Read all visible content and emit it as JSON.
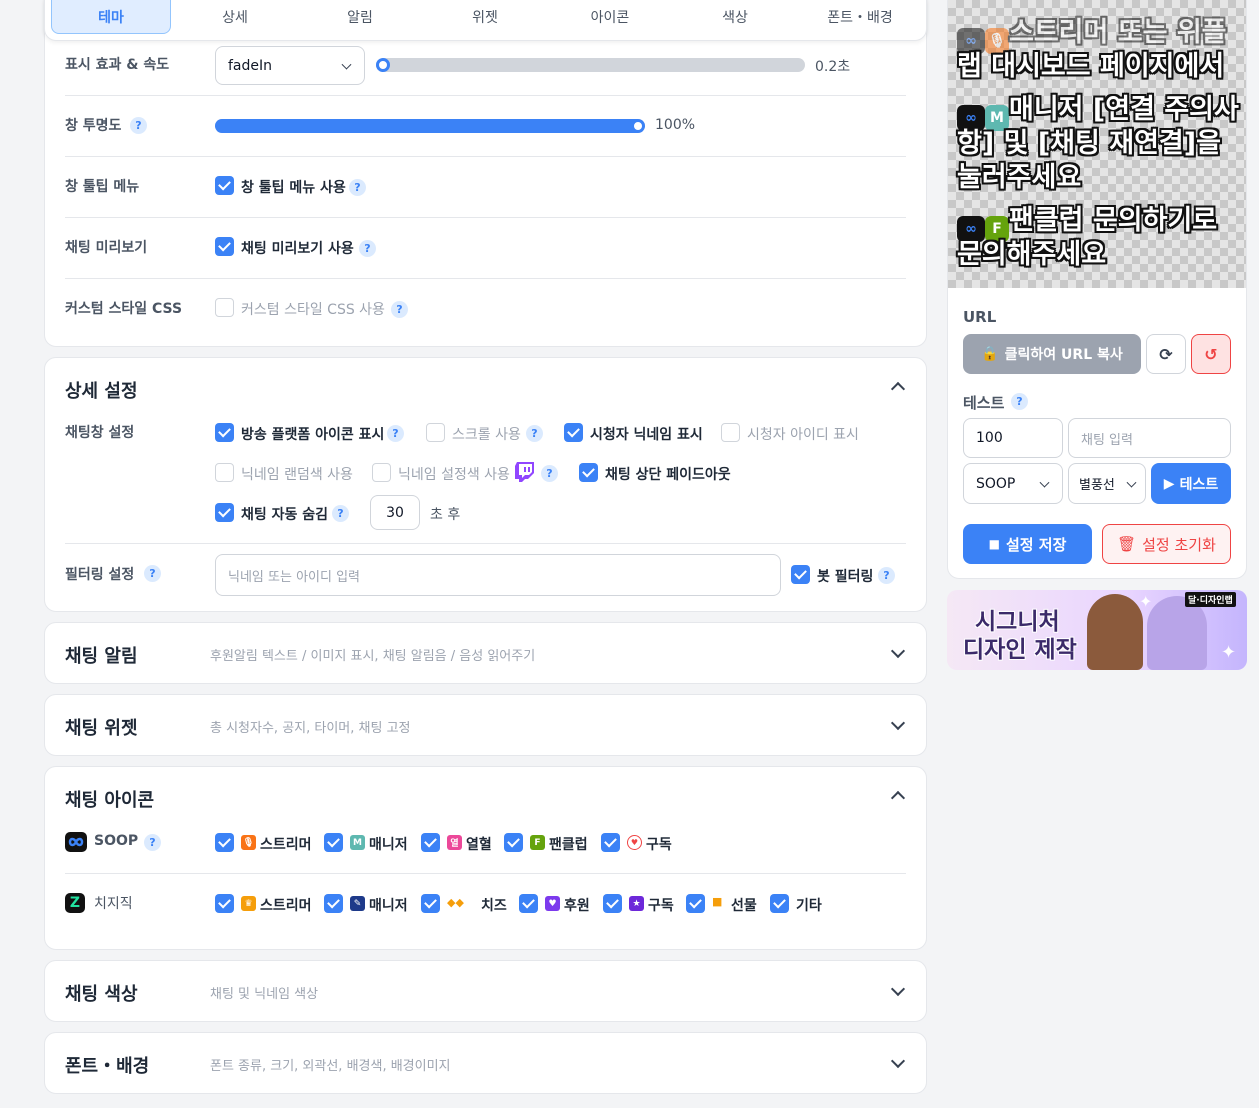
{
  "tabs": [
    {
      "label": "테마",
      "active": true
    },
    {
      "label": "상세",
      "active": false
    },
    {
      "label": "알림",
      "active": false
    },
    {
      "label": "위젯",
      "active": false
    },
    {
      "label": "아이콘",
      "active": false
    },
    {
      "label": "색상",
      "active": false
    },
    {
      "label": "폰트・배경",
      "active": false
    }
  ],
  "theme": {
    "effect_label": "표시 효과 & 속도",
    "effect_value": "fadeIn",
    "speed_value": "0.2초",
    "speed_fraction": 0.03,
    "opacity_label": "창 투명도",
    "opacity_value": "100%",
    "opacity_fraction": 1.0,
    "tooltip_label": "창 툴팁 메뉴",
    "tooltip_cb": "창 툴팁 메뉴 사용",
    "preview_label": "채팅 미리보기",
    "preview_cb": "채팅 미리보기 사용",
    "css_label": "커스텀 스타일 CSS",
    "css_cb": "커스텀 스타일 CSS 사용"
  },
  "detail": {
    "title": "상세 설정",
    "chat_label": "채팅창 설정",
    "options": {
      "platform_icon": "방송 플랫폼 아이콘 표시",
      "scroll": "스크롤 사용",
      "viewer_nick": "시청자 닉네임 표시",
      "viewer_id": "시청자 아이디 표시",
      "nick_random": "닉네임 랜덤색 사용",
      "nick_setcolor": "닉네임 설정색 사용",
      "top_fadeout": "채팅 상단 페이드아웃",
      "auto_hide": "채팅 자동 숨김"
    },
    "auto_hide_value": "30",
    "auto_hide_unit": "초 후",
    "filter_label": "필터링 설정",
    "filter_placeholder": "닉네임 또는 아이디 입력",
    "bot_filter": "봇 필터링"
  },
  "sections": {
    "alert_title": "채팅 알림",
    "alert_desc": "후원알림 텍스트 / 이미지 표시, 채팅 알림음 / 음성 읽어주기",
    "widget_title": "채팅 위젯",
    "widget_desc": "총 시청자수, 공지, 타이머, 채팅 고정",
    "icon_title": "채팅 아이콘",
    "color_title": "채팅 색상",
    "color_desc": "채팅 및 닉네임 색상",
    "font_title": "폰트・배경",
    "font_desc": "폰트 종류, 크기, 외곽선, 배경색, 배경이미지"
  },
  "icons": {
    "soop_label": "SOOP",
    "soop_items": [
      {
        "label": "스트리머",
        "icon": "mic-icon",
        "color": "#f97316"
      },
      {
        "label": "매니저",
        "icon": "manager-m-icon",
        "color": "#5eb8b0",
        "glyph": "M"
      },
      {
        "label": "열혈",
        "icon": "fan-badge-icon",
        "color": "#ec4899",
        "glyph": "열"
      },
      {
        "label": "팬클럽",
        "icon": "fanclub-f-icon",
        "color": "#65a30d",
        "glyph": "F"
      },
      {
        "label": "구독",
        "icon": "subscribe-heart-icon",
        "color": "#ef4444"
      }
    ],
    "chzzk_label": "치지직",
    "chzzk_items": [
      {
        "label": "스트리머",
        "icon": "crown-icon",
        "color": "#f59e0b"
      },
      {
        "label": "매니저",
        "icon": "wrench-icon",
        "color": "#2563eb"
      },
      {
        "label": "치즈",
        "icon": "cheese-icon",
        "color": "#f59e0b"
      },
      {
        "label": "후원",
        "icon": "heart-icon",
        "color": "#7c3aed"
      },
      {
        "label": "구독",
        "icon": "star-icon",
        "color": "#7c3aed"
      },
      {
        "label": "선물",
        "icon": "gift-icon",
        "color": "#f59e0b"
      },
      {
        "label": "기타",
        "icon": "",
        "color": ""
      }
    ]
  },
  "preview": {
    "line1": "스트리머 또는 위플",
    "line2": "랩 대시보드 페이지에서",
    "line3a": "매니저 [연결 주의사",
    "line3b": "항] 및 [채팅 재연결]을",
    "line3c": "눌러주세요",
    "line4a": "팬클럽 문의하기로",
    "line4b": "문의해주세요",
    "m_glyph": "M",
    "f_glyph": "F"
  },
  "panel": {
    "url_label": "URL",
    "copy_button": "클릭하여 URL 복사",
    "test_label": "테스트",
    "test_amount": "100",
    "chat_placeholder": "채팅 입력",
    "platform": "SOOP",
    "balloon": "별풍선",
    "test_button": "테스트",
    "save_button": "설정 저장",
    "reset_button": "설정 초기화"
  },
  "banner": {
    "line1": "시그니처",
    "line2": "디자인 제작",
    "tag": "달·디자인랩"
  },
  "colors": {
    "accent": "#3b82f6",
    "danger": "#ef4444"
  }
}
